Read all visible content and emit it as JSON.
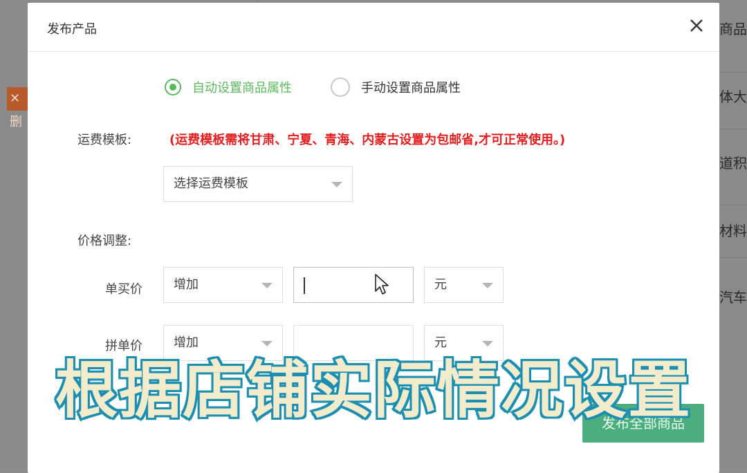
{
  "dialog": {
    "title": "发布产品"
  },
  "radio_options": [
    {
      "label": "自动设置商品属性",
      "checked": true
    },
    {
      "label": "手动设置商品属性",
      "checked": false
    }
  ],
  "shipping": {
    "label": "运费模板:",
    "warning": "(运费模板需将甘肃、宁夏、青海、内蒙古设置为包邮省,才可正常使用。)",
    "select_value": "选择运费模板"
  },
  "price_adjust": {
    "label": "价格调整:",
    "rows": [
      {
        "label": "单买价",
        "mode": "增加",
        "value": "",
        "unit": "元"
      },
      {
        "label": "拼单价",
        "mode": "增加",
        "value": "",
        "unit": "元"
      }
    ]
  },
  "publish_button": "发布全部商品",
  "caption": "根据店铺实际情况设置",
  "background": {
    "left_button": "✕ 删",
    "right_items": [
      "商品积",
      "体大小",
      "道积木",
      "材料拼",
      "汽车音"
    ]
  },
  "colors": {
    "accent_green": "#5cb85c",
    "warning_red": "#e02020",
    "button_green": "#4cae7e",
    "caption_fill": "#f2eccd",
    "caption_stroke": "#1d8fb0"
  }
}
